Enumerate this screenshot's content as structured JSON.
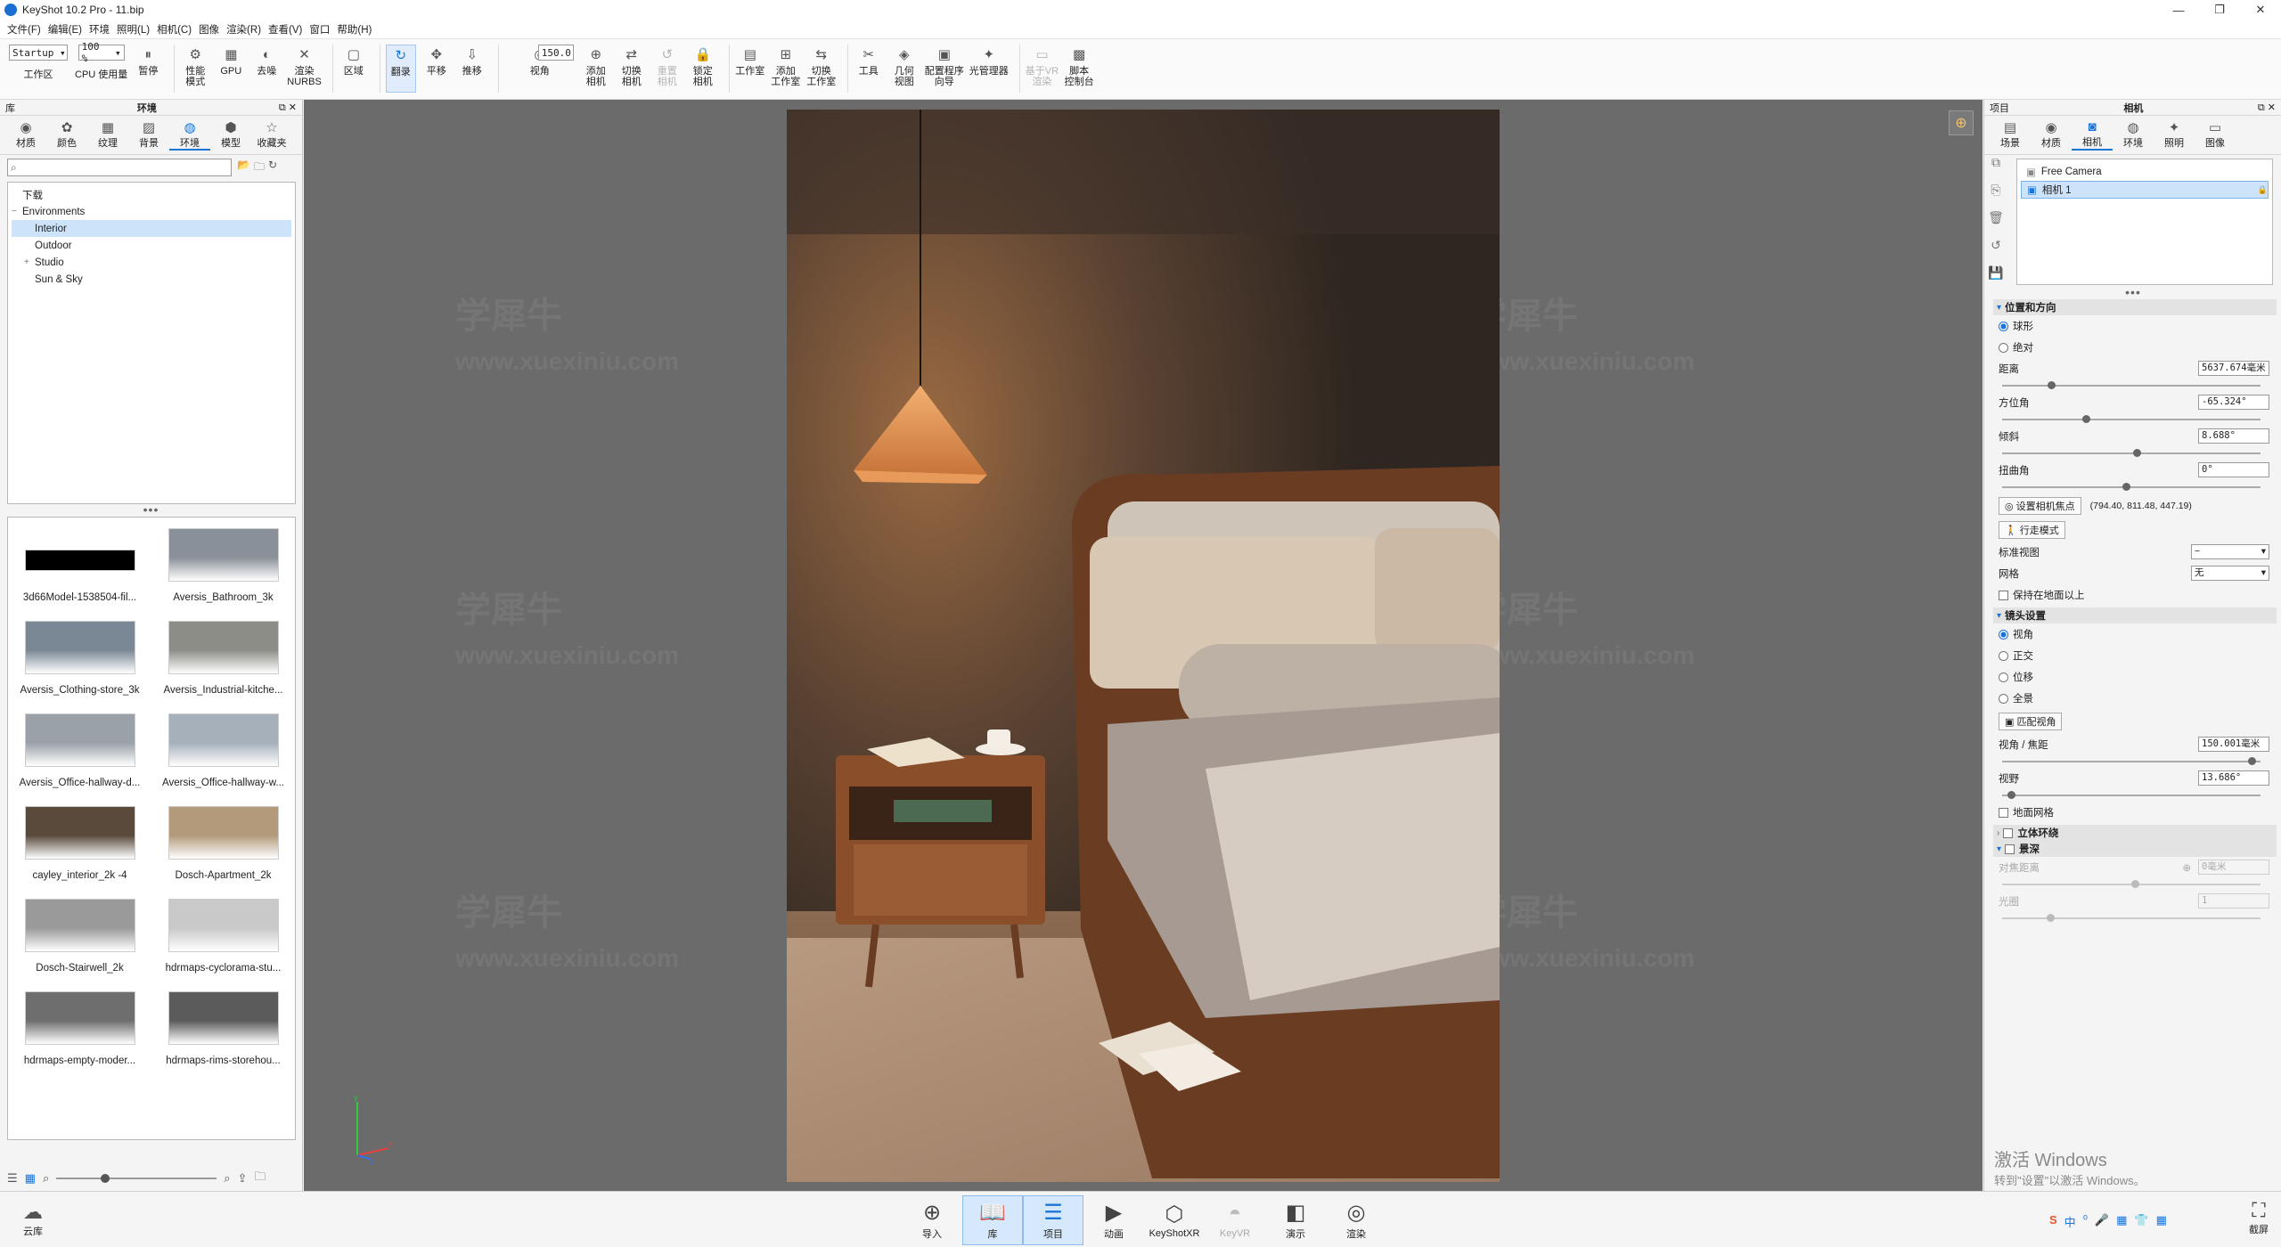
{
  "window": {
    "title": "KeyShot 10.2 Pro  - 11.bip",
    "controls": [
      "—",
      "❐",
      "✕"
    ]
  },
  "menu": [
    "文件(F)",
    "编辑(E)",
    "环境",
    "照明(L)",
    "相机(C)",
    "图像",
    "渲染(R)",
    "查看(V)",
    "窗口",
    "帮助(H)"
  ],
  "toolbar": {
    "workspace_value": "Startup",
    "workspace_label": "工作区",
    "zoom_value": "100 %",
    "cpu_label": "CPU 使用量",
    "fov_value": "150.0",
    "buttons": [
      {
        "icon": "pause-icon",
        "glyph": "⏸",
        "label": "暂停",
        "state": "normal"
      },
      {
        "icon": "performance-icon",
        "glyph": "⚙",
        "label": "性能\n模式",
        "state": "normal"
      },
      {
        "icon": "gpu-icon",
        "glyph": "▦",
        "label": "GPU",
        "state": "normal"
      },
      {
        "icon": "denoise-icon",
        "glyph": "◐",
        "label": "去噪",
        "state": "normal"
      },
      {
        "icon": "render-nurbs-icon",
        "glyph": "✕",
        "label": "渲染\nNURBS",
        "state": "normal"
      },
      {
        "icon": "region-icon",
        "glyph": "▢",
        "label": "区域",
        "state": "normal"
      },
      {
        "icon": "tumble-icon",
        "glyph": "↻",
        "label": "翻录",
        "state": "active"
      },
      {
        "icon": "pan-icon",
        "glyph": "✥",
        "label": "平移",
        "state": "normal"
      },
      {
        "icon": "dolly-icon",
        "glyph": "⇩",
        "label": "推移",
        "state": "normal"
      },
      {
        "icon": "fov-icon",
        "glyph": "◎",
        "label": "视角",
        "state": "normal"
      },
      {
        "icon": "add-camera-icon",
        "glyph": "⊕",
        "label": "添加\n相机",
        "state": "normal"
      },
      {
        "icon": "switch-camera-icon",
        "glyph": "⇄",
        "label": "切换\n相机",
        "state": "normal"
      },
      {
        "icon": "reset-camera-icon",
        "glyph": "↺",
        "label": "重置\n相机",
        "state": "disabled"
      },
      {
        "icon": "lock-camera-icon",
        "glyph": "🔒",
        "label": "锁定\n相机",
        "state": "normal"
      },
      {
        "icon": "studio-icon",
        "glyph": "▤",
        "label": "工作室",
        "state": "normal"
      },
      {
        "icon": "add-studio-icon",
        "glyph": "⊞",
        "label": "添加\n工作室",
        "state": "normal"
      },
      {
        "icon": "switch-studio-icon",
        "glyph": "⇆",
        "label": "切换\n工作室",
        "state": "normal"
      },
      {
        "icon": "tools-icon",
        "glyph": "✂",
        "label": "工具",
        "state": "normal"
      },
      {
        "icon": "geometry-view-icon",
        "glyph": "◈",
        "label": "几何\n视图",
        "state": "normal"
      },
      {
        "icon": "configurator-icon",
        "glyph": "▣",
        "label": "配置程序\n向导",
        "state": "normal"
      },
      {
        "icon": "light-manager-icon",
        "glyph": "✦",
        "label": "光管理器",
        "state": "normal"
      },
      {
        "icon": "vr-render-icon",
        "glyph": "▭",
        "label": "基于VR\n渲染",
        "state": "disabled"
      },
      {
        "icon": "script-console-icon",
        "glyph": "▩",
        "label": "脚本\n控制台",
        "state": "normal"
      }
    ]
  },
  "library": {
    "header_left": "库",
    "header_title": "环境",
    "tabs": [
      {
        "label": "材质",
        "glyph": "◉",
        "icon": "materials-icon"
      },
      {
        "label": "颜色",
        "glyph": "✿",
        "icon": "colors-icon"
      },
      {
        "label": "纹理",
        "glyph": "▦",
        "icon": "textures-icon"
      },
      {
        "label": "背景",
        "glyph": "▨",
        "icon": "backgrounds-icon"
      },
      {
        "label": "环境",
        "glyph": "◍",
        "icon": "environments-icon"
      },
      {
        "label": "模型",
        "glyph": "⬢",
        "icon": "models-icon"
      },
      {
        "label": "收藏夹",
        "glyph": "☆",
        "icon": "favorites-icon"
      }
    ],
    "active_tab": 4,
    "search_placeholder": "",
    "tree": [
      {
        "label": "下载",
        "indent": 0,
        "exp": "",
        "selected": false
      },
      {
        "label": "Environments",
        "indent": 0,
        "exp": "−",
        "selected": false
      },
      {
        "label": "Interior",
        "indent": 1,
        "exp": "",
        "selected": true
      },
      {
        "label": "Outdoor",
        "indent": 1,
        "exp": "",
        "selected": false
      },
      {
        "label": "Studio",
        "indent": 1,
        "exp": "+",
        "selected": false
      },
      {
        "label": "Sun & Sky",
        "indent": 1,
        "exp": "",
        "selected": false
      }
    ],
    "thumbnails": [
      {
        "name": "3d66Model-1538504-fil...",
        "color": "#000000"
      },
      {
        "name": "Aversis_Bathroom_3k",
        "color": "#8a9099"
      },
      {
        "name": "Aversis_Clothing-store_3k",
        "color": "#7a8896"
      },
      {
        "name": "Aversis_Industrial-kitche...",
        "color": "#8d8d88"
      },
      {
        "name": "Aversis_Office-hallway-d...",
        "color": "#9aa1a9"
      },
      {
        "name": "Aversis_Office-hallway-w...",
        "color": "#a6b0bb"
      },
      {
        "name": "cayley_interior_2k -4",
        "color": "#5a4a3c"
      },
      {
        "name": "Dosch-Apartment_2k",
        "color": "#b39a7a"
      },
      {
        "name": "Dosch-Stairwell_2k",
        "color": "#9a9a9a"
      },
      {
        "name": "hdrmaps-cyclorama-stu...",
        "color": "#c9c9c9"
      },
      {
        "name": "hdrmaps-empty-moder...",
        "color": "#6e6e6e"
      },
      {
        "name": "hdrmaps-rims-storehou...",
        "color": "#5b5b5b"
      }
    ]
  },
  "viewport": {
    "watermark_cn": "学犀牛",
    "watermark_url": "www.xuexiniu.com"
  },
  "project": {
    "header_left": "项目",
    "header_title": "相机",
    "tabs": [
      {
        "label": "场景",
        "glyph": "▤",
        "icon": "scene-icon"
      },
      {
        "label": "材质",
        "glyph": "◉",
        "icon": "materials-icon"
      },
      {
        "label": "相机",
        "glyph": "◙",
        "icon": "camera-icon"
      },
      {
        "label": "环境",
        "glyph": "◍",
        "icon": "environment-icon"
      },
      {
        "label": "照明",
        "glyph": "✦",
        "icon": "lighting-icon"
      },
      {
        "label": "图像",
        "glyph": "▭",
        "icon": "image-icon"
      }
    ],
    "active_tab": 2,
    "cameras": [
      {
        "name": "Free Camera",
        "selected": false
      },
      {
        "name": "相机 1",
        "selected": true
      }
    ],
    "position_section": "位置和方向",
    "mode_spherical": "球形",
    "mode_absolute": "绝对",
    "distance_label": "距离",
    "distance_value": "5637.674毫米",
    "azimuth_label": "方位角",
    "azimuth_value": "-65.324°",
    "incline_label": "倾斜",
    "incline_value": "8.688°",
    "twist_label": "扭曲角",
    "twist_value": "0°",
    "set_focus_btn": "设置相机焦点",
    "focus_coords": "(794.40, 811.48, 447.19)",
    "walk_mode_btn": "行走模式",
    "standard_view_label": "标准视图",
    "standard_view_value": "−",
    "grid_label": "网格",
    "grid_value": "无",
    "keep_above_ground": "保持在地面以上",
    "lens_section": "镜头设置",
    "lens_fov": "视角",
    "lens_ortho": "正交",
    "lens_shift": "位移",
    "lens_panorama": "全景",
    "match_fov_btn": "匹配视角",
    "fov_focal_label": "视角 / 焦距",
    "fov_focal_value": "150.001毫米",
    "field_label": "视野",
    "field_value": "13.686°",
    "ground_grid": "地面网格",
    "stereo_section": "立体环绕",
    "dof_section": "景深",
    "focus_distance_label": "对焦距离",
    "focus_distance_value": "0毫米",
    "aperture_label": "光圈",
    "aperture_value": "1",
    "slider_distance": 0.18,
    "slider_azimuth": 0.32,
    "slider_incline": 0.52,
    "slider_twist": 0.48,
    "slider_fov_focal": 0.98,
    "slider_field": 0.02
  },
  "activation": {
    "line1": "激活 Windows",
    "line2": "转到\"设置\"以激活 Windows。"
  },
  "bottombar": {
    "cloud_label": "云库",
    "buttons": [
      {
        "label": "导入",
        "glyph": "⊕",
        "icon": "import-icon",
        "state": "normal"
      },
      {
        "label": "库",
        "glyph": "📖",
        "icon": "library-icon",
        "state": "active"
      },
      {
        "label": "项目",
        "glyph": "☰",
        "icon": "project-icon",
        "state": "active"
      },
      {
        "label": "动画",
        "glyph": "▶",
        "icon": "animation-icon",
        "state": "normal"
      },
      {
        "label": "KeyShotXR",
        "glyph": "⬡",
        "icon": "keyshotxr-icon",
        "state": "normal"
      },
      {
        "label": "KeyVR",
        "glyph": "◓",
        "icon": "keyvr-icon",
        "state": "disabled"
      },
      {
        "label": "演示",
        "glyph": "◧",
        "icon": "presentation-icon",
        "state": "normal"
      },
      {
        "label": "渲染",
        "glyph": "◎",
        "icon": "render-icon",
        "state": "normal"
      }
    ],
    "screenshot_label": "截屏",
    "tray": [
      "S",
      "中",
      "⁰",
      "🎤",
      "▦",
      "👕",
      "▦"
    ]
  }
}
